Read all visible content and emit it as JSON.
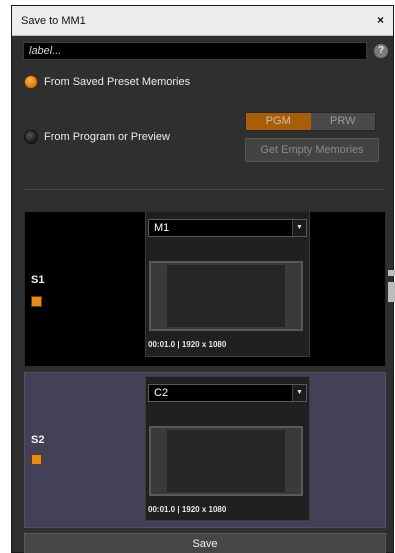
{
  "window": {
    "title": "Save to MM1",
    "close_glyph": "×"
  },
  "label_field": {
    "value": "",
    "placeholder": "label..."
  },
  "help": {
    "glyph": "?"
  },
  "options": {
    "saved_presets": {
      "label": "From Saved Preset Memories",
      "selected": true
    },
    "program_preview": {
      "label": "From Program or Preview",
      "selected": false
    }
  },
  "source_toggle": {
    "pgm_label": "PGM",
    "prw_label": "PRW",
    "active": "PGM"
  },
  "get_empty_label": "Get Empty Memories",
  "slots": [
    {
      "name": "S1",
      "selection": "M1",
      "info": "00:01.0 | 1920 x 1080",
      "checked": true
    },
    {
      "name": "S2",
      "selection": "C2",
      "info": "00:01.0 | 1920 x 1080",
      "checked": true
    }
  ],
  "save_label": "Save",
  "colors": {
    "accent_orange": "#e07a10",
    "pgm_active": "#a85e08",
    "s2_background": "#434058"
  },
  "icons": {
    "dropdown_arrow": "▼"
  }
}
